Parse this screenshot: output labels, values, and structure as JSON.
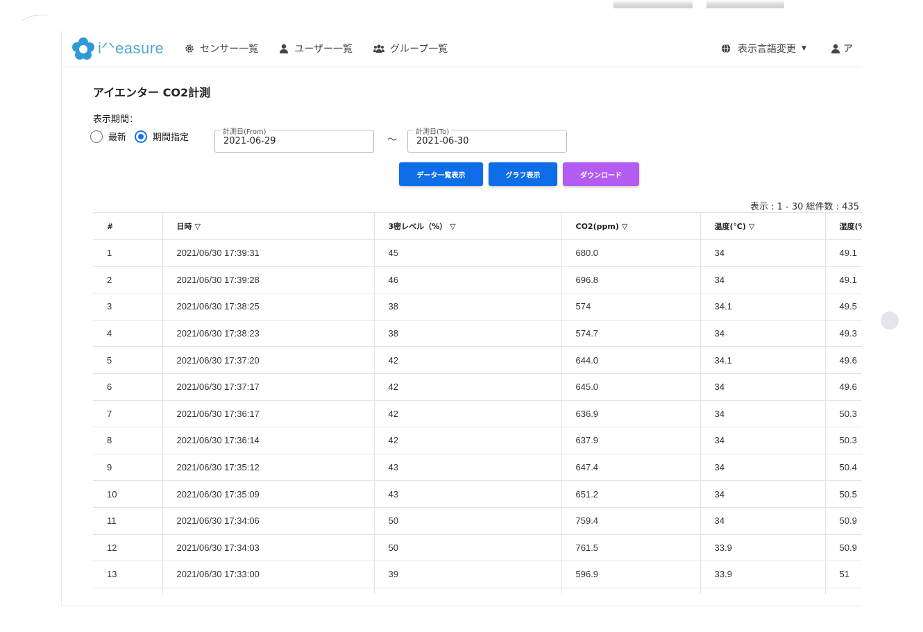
{
  "app": {
    "logo_text": "i-Measure",
    "logo_display": "iᐟᐠeasure"
  },
  "nav": {
    "items": [
      {
        "label": "センサー一覧",
        "icon": "gear-icon"
      },
      {
        "label": "ユーザー一覧",
        "icon": "user-icon"
      },
      {
        "label": "グループ一覧",
        "icon": "users-icon"
      }
    ],
    "language_label": "表示言語変更",
    "language_icon": "globe-icon",
    "account_label": "ア"
  },
  "page": {
    "title": "アイエンター CO2計測",
    "period_label": "表示期間：",
    "radio_latest": "最新",
    "radio_range": "期間指定",
    "selected_radio": "期間指定",
    "from_legend": "計測日(From)",
    "from_value": "2021-06-29",
    "to_legend": "計測日(To)",
    "to_value": "2021-06-30",
    "tilde": "〜",
    "btn_list": "データ一覧表示",
    "btn_graph": "グラフ表示",
    "btn_download": "ダウンロード",
    "summary": "表示 : 1 - 30  総件数 : 435"
  },
  "colors": {
    "primary": "#0d6ee8",
    "download": "#b35bf2",
    "logo": "#4aa8d8"
  },
  "table": {
    "headers": [
      {
        "label": "#",
        "sort": ""
      },
      {
        "label": "日時",
        "sort": "▽"
      },
      {
        "label": "3密レベル（%）",
        "sort": "▽"
      },
      {
        "label": "CO2(ppm)",
        "sort": "▽"
      },
      {
        "label": "温度(℃)",
        "sort": "▽"
      },
      {
        "label": "湿度(%",
        "sort": ""
      }
    ],
    "rows": [
      [
        "1",
        "2021/06/30 17:39:31",
        "45",
        "680.0",
        "34",
        "49.1"
      ],
      [
        "2",
        "2021/06/30 17:39:28",
        "46",
        "696.8",
        "34",
        "49.1"
      ],
      [
        "3",
        "2021/06/30 17:38:25",
        "38",
        "574",
        "34.1",
        "49.5"
      ],
      [
        "4",
        "2021/06/30 17:38:23",
        "38",
        "574.7",
        "34",
        "49.3"
      ],
      [
        "5",
        "2021/06/30 17:37:20",
        "42",
        "644.0",
        "34.1",
        "49.6"
      ],
      [
        "6",
        "2021/06/30 17:37:17",
        "42",
        "645.0",
        "34",
        "49.6"
      ],
      [
        "7",
        "2021/06/30 17:36:17",
        "42",
        "636.9",
        "34",
        "50.3"
      ],
      [
        "8",
        "2021/06/30 17:36:14",
        "42",
        "637.9",
        "34",
        "50.3"
      ],
      [
        "9",
        "2021/06/30 17:35:12",
        "43",
        "647.4",
        "34",
        "50.4"
      ],
      [
        "10",
        "2021/06/30 17:35:09",
        "43",
        "651.2",
        "34",
        "50.5"
      ],
      [
        "11",
        "2021/06/30 17:34:06",
        "50",
        "759.4",
        "34",
        "50.9"
      ],
      [
        "12",
        "2021/06/30 17:34:03",
        "50",
        "761.5",
        "33.9",
        "50.9"
      ],
      [
        "13",
        "2021/06/30 17:33:00",
        "39",
        "596.9",
        "33.9",
        "51"
      ],
      [
        "",
        "",
        "",
        "",
        "",
        ""
      ]
    ]
  }
}
